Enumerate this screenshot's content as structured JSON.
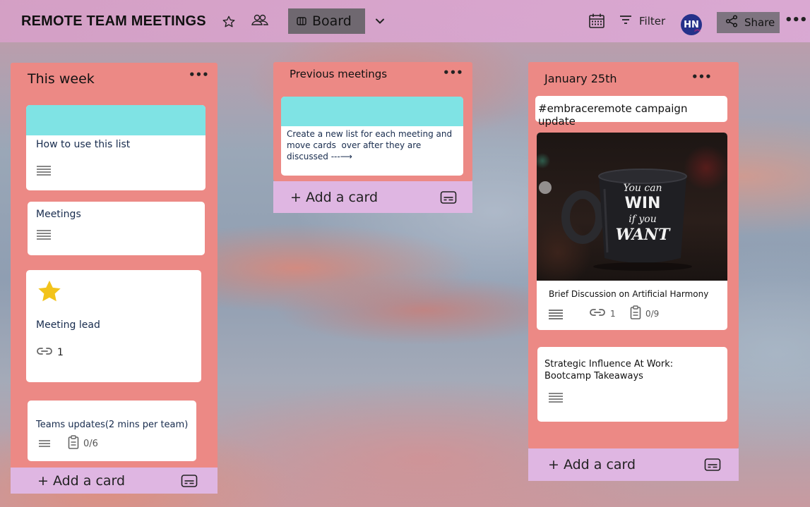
{
  "board": {
    "title": "REMOTE TEAM MEETINGS",
    "view_label": "Board",
    "filter_label": "Filter",
    "avatar_initials": "HN",
    "share_label": "Share"
  },
  "lists": [
    {
      "title": "This week",
      "cards": [
        {
          "title": "How to use this list",
          "cover": "#7fe3e4",
          "icons": [
            "description-icon"
          ]
        },
        {
          "title": "Meetings",
          "icons": [
            "description-icon"
          ]
        },
        {
          "title": "Meeting lead",
          "sticker": "star",
          "icons": [
            "attachment-icon"
          ],
          "attachments": "1"
        },
        {
          "title": "Teams updates(2 mins per team)",
          "icons": [
            "description-icon",
            "checklist-icon"
          ],
          "checklist": "0/6"
        }
      ],
      "add_label": "+ Add a card"
    },
    {
      "title": "Previous meetings",
      "cards": [
        {
          "title": "Create a new list for each meeting and move cards  over after they are  discussed ---⟶",
          "cover": "#7fe3e4"
        }
      ],
      "add_label": "+ Add a card"
    },
    {
      "title": "January 25th",
      "cards": [
        {
          "title": "#embraceremote campaign update"
        },
        {
          "title": "Brief Discussion on Artificial Harmony",
          "image": "mug-photo",
          "mug_text": [
            "You can",
            "WIN",
            "if you",
            "WANT"
          ],
          "icons": [
            "description-icon",
            "attachment-icon",
            "checklist-icon"
          ],
          "attachments": "1",
          "checklist": "0/9"
        },
        {
          "title": "Strategic Influence At Work: Bootcamp Takeaways",
          "icons": [
            "description-icon"
          ]
        }
      ],
      "add_label": "+ Add a card"
    }
  ],
  "colors": {
    "list_bg": "#ec8985",
    "add_card_bg": "#dfb6e2",
    "card_cover": "#7fe3e4",
    "view_button_bg": "#6f6870",
    "share_button_bg": "#7e7480",
    "avatar_bg": "#25318a",
    "star": "#f2c31b"
  }
}
